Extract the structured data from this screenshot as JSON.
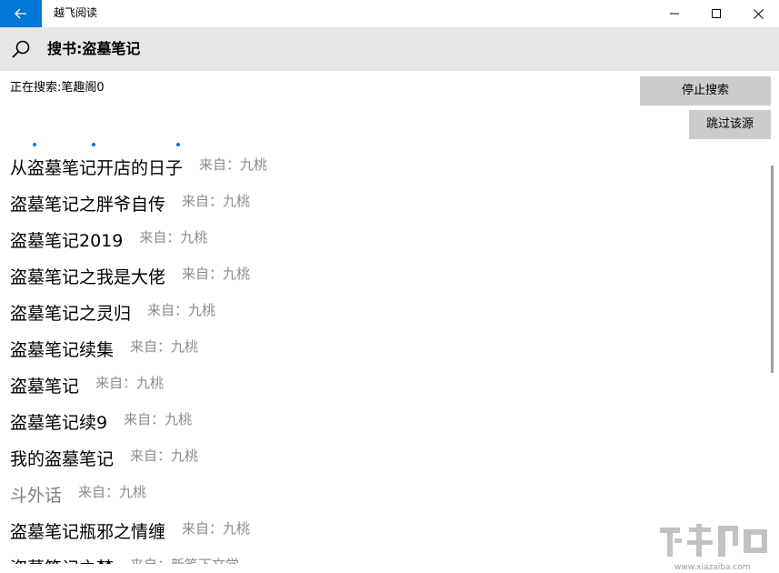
{
  "window": {
    "title": "越飞阅读",
    "controls": [
      "minimize-icon",
      "maximize-icon",
      "close-icon"
    ]
  },
  "header": {
    "search_title": "搜书:盗墓笔记"
  },
  "status": {
    "text": "正在搜索:笔趣阁0"
  },
  "buttons": {
    "stop": "停止搜索",
    "skip": "跳过该源"
  },
  "results": [
    {
      "title": "从盗墓笔记开店的日子",
      "source": "来自：九桃",
      "muted": false
    },
    {
      "title": "盗墓笔记之胖爷自传",
      "source": "来自：九桃",
      "muted": false
    },
    {
      "title": "盗墓笔记2019",
      "source": "来自：九桃",
      "muted": false
    },
    {
      "title": "盗墓笔记之我是大佬",
      "source": "来自：九桃",
      "muted": false
    },
    {
      "title": "盗墓笔记之灵归",
      "source": "来自：九桃",
      "muted": false
    },
    {
      "title": "盗墓笔记续集",
      "source": "来自：九桃",
      "muted": false
    },
    {
      "title": "盗墓笔记",
      "source": "来自：九桃",
      "muted": false
    },
    {
      "title": "盗墓笔记续9",
      "source": "来自：九桃",
      "muted": false
    },
    {
      "title": "我的盗墓笔记",
      "source": "来自：九桃",
      "muted": false
    },
    {
      "title": "斗外话",
      "source": "来自：九桃",
      "muted": true
    },
    {
      "title": "盗墓笔记瓶邪之情缠",
      "source": "来自：九桃",
      "muted": false
    },
    {
      "title": "盗墓笔记之梦",
      "source": "来自：新笔下文学",
      "muted": false
    }
  ],
  "watermark": {
    "text": "www.xiazaiba.com"
  },
  "colors": {
    "accent": "#0078d7",
    "header_bg": "#e6e6e6",
    "button_bg": "#cccccc",
    "source_text": "#8c8c8c"
  }
}
